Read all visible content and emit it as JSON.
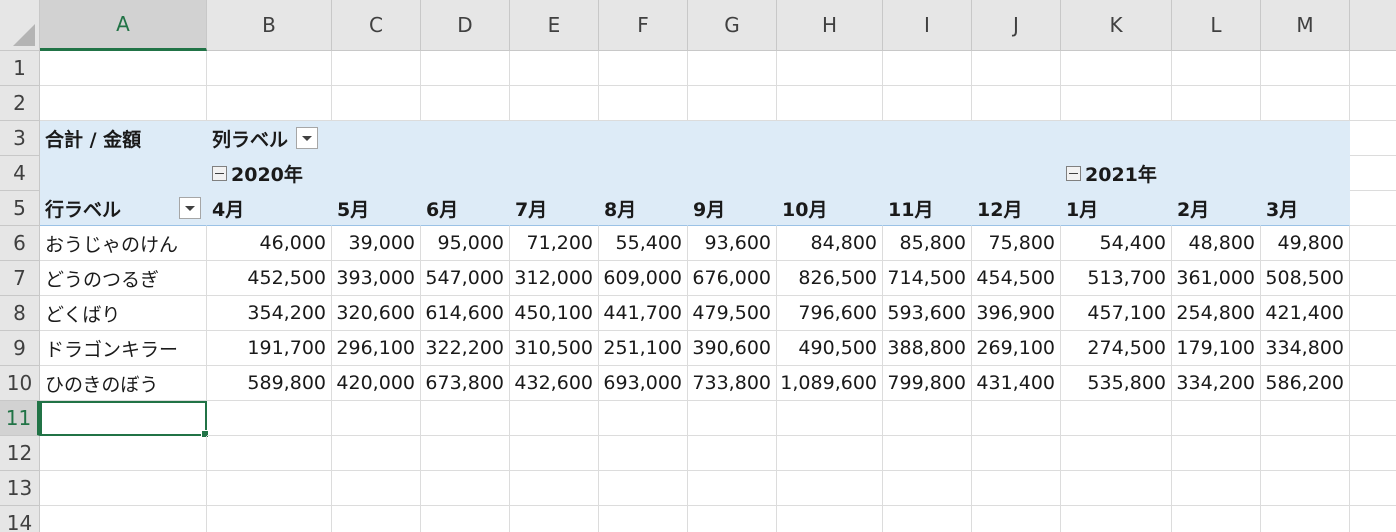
{
  "columns": [
    "A",
    "B",
    "C",
    "D",
    "E",
    "F",
    "G",
    "H",
    "I",
    "J",
    "K",
    "L",
    "M"
  ],
  "rows": [
    "1",
    "2",
    "3",
    "4",
    "5",
    "6",
    "7",
    "8",
    "9",
    "10",
    "11",
    "12",
    "13",
    "14"
  ],
  "pivot": {
    "value_field": "合計 / 金額",
    "column_label": "列ラベル",
    "row_label": "行ラベル",
    "years": {
      "y2020": "2020年",
      "y2021": "2021年"
    },
    "months": [
      "4月",
      "5月",
      "6月",
      "7月",
      "8月",
      "9月",
      "10月",
      "11月",
      "12月",
      "1月",
      "2月",
      "3月"
    ],
    "data": [
      {
        "name": "おうじゃのけん",
        "values": [
          "46,000",
          "39,000",
          "95,000",
          "71,200",
          "55,400",
          "93,600",
          "84,800",
          "85,800",
          "75,800",
          "54,400",
          "48,800",
          "49,800"
        ]
      },
      {
        "name": "どうのつるぎ",
        "values": [
          "452,500",
          "393,000",
          "547,000",
          "312,000",
          "609,000",
          "676,000",
          "826,500",
          "714,500",
          "454,500",
          "513,700",
          "361,000",
          "508,500"
        ]
      },
      {
        "name": "どくばり",
        "values": [
          "354,200",
          "320,600",
          "614,600",
          "450,100",
          "441,700",
          "479,500",
          "796,600",
          "593,600",
          "396,900",
          "457,100",
          "254,800",
          "421,400"
        ]
      },
      {
        "name": "ドラゴンキラー",
        "values": [
          "191,700",
          "296,100",
          "322,200",
          "310,500",
          "251,100",
          "390,600",
          "490,500",
          "388,800",
          "269,100",
          "274,500",
          "179,100",
          "334,800"
        ]
      },
      {
        "name": "ひのきのぼう",
        "values": [
          "589,800",
          "420,000",
          "673,800",
          "432,600",
          "693,000",
          "733,800",
          "1,089,600",
          "799,800",
          "431,400",
          "535,800",
          "334,200",
          "586,200"
        ]
      }
    ]
  },
  "selection": {
    "active_cell": "A11"
  },
  "colors": {
    "pivot_fill": "#ddebf7",
    "header_fill": "#e6e6e6",
    "accent": "#217346"
  }
}
